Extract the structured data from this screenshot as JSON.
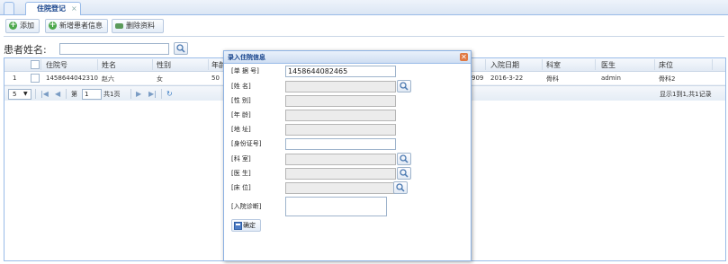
{
  "tab": {
    "label": "住院登记",
    "close": "×"
  },
  "toolbar": {
    "add_label": "添加",
    "add_patient_label": "新增患者信息",
    "delete_label": "删除资料"
  },
  "search": {
    "label": "患者姓名:",
    "value": ""
  },
  "grid": {
    "columns": [
      "住院号",
      "姓名",
      "性别",
      "年龄",
      "入院日期",
      "科室",
      "医生",
      "床位"
    ],
    "rows": [
      {
        "index": "1",
        "admission_no": "1458644042310",
        "name": "赵六",
        "gender": "女",
        "age": "50",
        "id_tail": "909",
        "date": "2016-3-22",
        "dept": "骨科",
        "doctor": "admin",
        "bed": "骨科2"
      }
    ]
  },
  "pager": {
    "page_size": "5",
    "page_label": "第",
    "page_value": "1",
    "page_total": "共1页",
    "summary": "显示1到1,共1记录"
  },
  "dialog": {
    "title": "录入住院信息",
    "close": "✕",
    "fields": {
      "doc_no_label": "[单  据  号]",
      "doc_no_value": "1458644082465",
      "name_label": "[姓         名]",
      "gender_label": "[性         别]",
      "age_label": "[年         龄]",
      "address_label": "[地         址]",
      "idcard_label": "[身份证号]",
      "dept_label": "[科         室]",
      "doctor_label": "[医         生]",
      "bed_label": "[床         位]",
      "diagnosis_label": "[入院诊断]"
    },
    "confirm_label": "确定"
  }
}
